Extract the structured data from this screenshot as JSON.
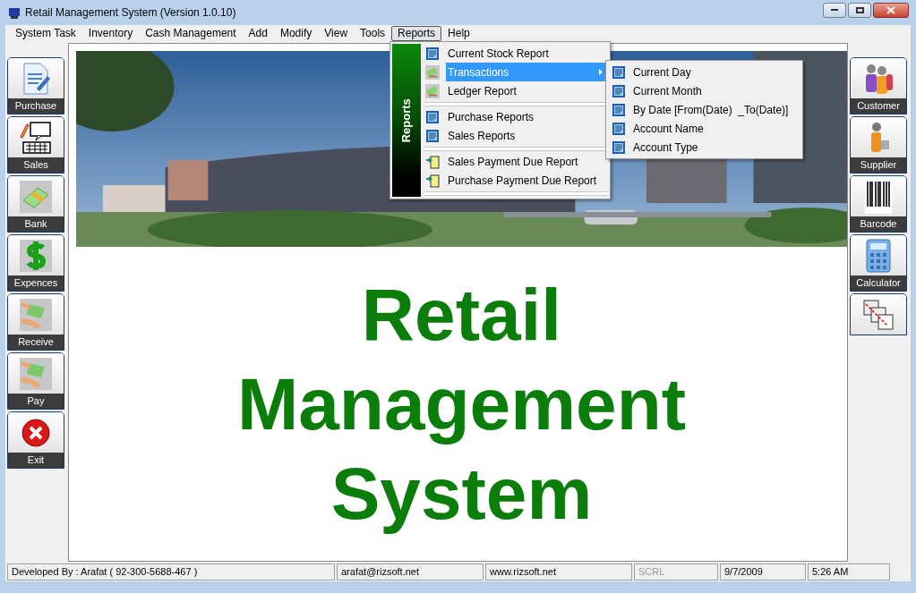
{
  "window": {
    "title": "Retail Management System (Version 1.0.10)"
  },
  "menu_bar": [
    {
      "label": "System Task",
      "selected": false
    },
    {
      "label": "Inventory",
      "selected": false
    },
    {
      "label": "Cash Management",
      "selected": false
    },
    {
      "label": "Add",
      "selected": false
    },
    {
      "label": "Modify",
      "selected": false
    },
    {
      "label": "View",
      "selected": false
    },
    {
      "label": "Tools",
      "selected": false
    },
    {
      "label": "Reports",
      "selected": true
    },
    {
      "label": "Help",
      "selected": false
    }
  ],
  "reports_menu": {
    "banner": "Reports",
    "items": [
      {
        "kind": "item",
        "label": "Current Stock Report",
        "selected": false
      },
      {
        "kind": "submenu",
        "label": "Transactions",
        "selected": true
      },
      {
        "kind": "item",
        "label": "Ledger Report",
        "selected": false
      },
      {
        "kind": "separator"
      },
      {
        "kind": "item",
        "label": "Purchase Reports",
        "selected": false
      },
      {
        "kind": "item",
        "label": "Sales Reports",
        "selected": false
      },
      {
        "kind": "separator"
      },
      {
        "kind": "item",
        "label": "Sales Payment Due Report",
        "selected": false
      },
      {
        "kind": "item",
        "label": "Purchase Payment Due Report",
        "selected": false
      },
      {
        "kind": "separator"
      }
    ]
  },
  "transactions_submenu": [
    {
      "label": "Current Day"
    },
    {
      "label": "Current Month"
    },
    {
      "label": "By Date [From(Date)  _To(Date)]"
    },
    {
      "label": "Account Name"
    },
    {
      "label": "Account Type"
    }
  ],
  "left_toolbar": [
    {
      "label": "Purchase"
    },
    {
      "label": "Sales"
    },
    {
      "label": "Bank"
    },
    {
      "label": "Expences"
    },
    {
      "label": "Receive"
    },
    {
      "label": "Pay"
    },
    {
      "label": "Exit"
    }
  ],
  "right_toolbar": [
    {
      "kind": "labeled",
      "label": "Customer"
    },
    {
      "kind": "labeled",
      "label": "Supplier"
    },
    {
      "kind": "labeled",
      "label": "Barcode"
    },
    {
      "kind": "labeled",
      "label": "Calculator"
    },
    {
      "kind": "icon_only"
    }
  ],
  "headline": "Retail Management System",
  "status_bar": [
    {
      "text": "Developed By : Arafat ( 92-300-5688-467 )",
      "disabled": false
    },
    {
      "text": "arafat@rizsoft.net",
      "disabled": false
    },
    {
      "text": "www.rizsoft.net",
      "disabled": false
    },
    {
      "text": "SCRL",
      "disabled": true
    },
    {
      "text": "9/7/2009",
      "disabled": false
    },
    {
      "text": "5:26 AM",
      "disabled": false
    }
  ]
}
